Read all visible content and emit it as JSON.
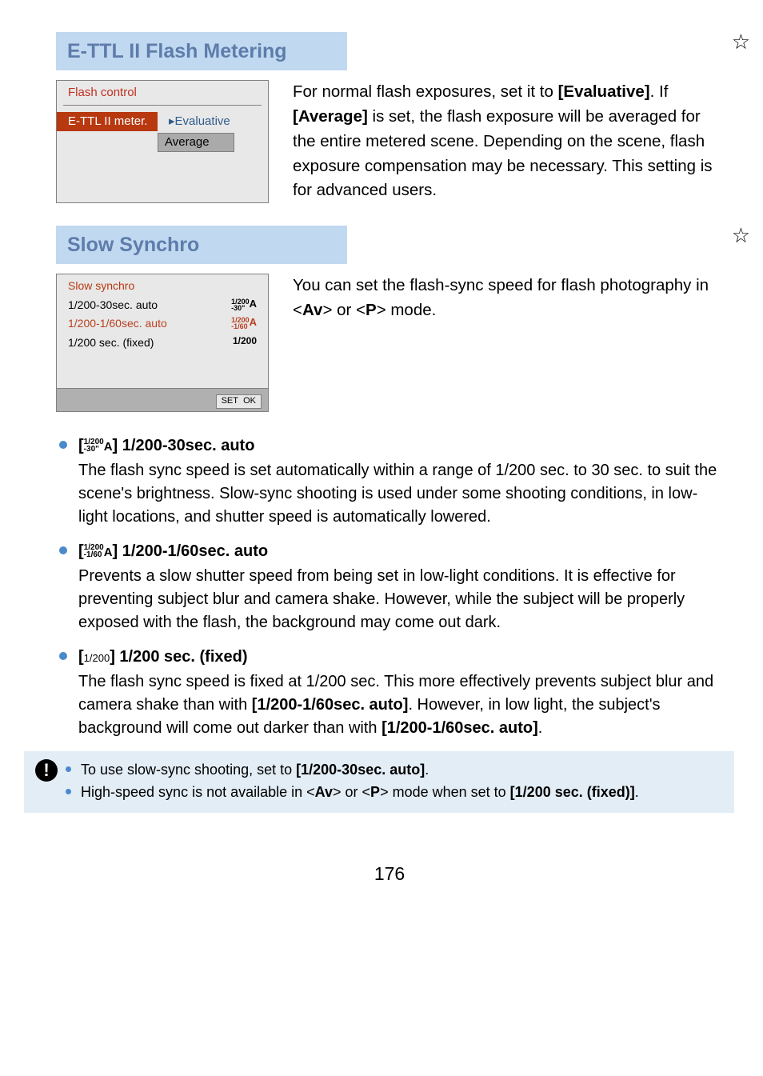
{
  "section1": {
    "title": "E-TTL II Flash Metering",
    "star": "☆",
    "menu": {
      "header": "Flash control",
      "row_label": "E-TTL II meter.",
      "opt_marker": "▸",
      "opt1": "Evaluative",
      "opt2": "Average"
    },
    "body": "For normal flash exposures, set it to [Evaluative]. If [Average] is set, the flash exposure will be averaged for the entire metered scene. Depending on the scene, flash exposure compensation may be necessary. This setting is for advanced users.",
    "body_bold1": "[Evaluative]",
    "body_bold2": "[Average]"
  },
  "section2": {
    "title": "Slow Synchro",
    "star": "☆",
    "menu": {
      "header": "Slow synchro",
      "r1_label": "1/200-30sec. auto",
      "r1_top": "1/200",
      "r1_bot": "-30\"",
      "r1_a": "A",
      "r2_label": "1/200-1/60sec. auto",
      "r2_top": "1/200",
      "r2_bot": "-1/60",
      "r2_a": "A",
      "r3_label": "1/200 sec. (fixed)",
      "r3_val": "1/200",
      "footer_set": "SET",
      "footer_ok": "OK"
    },
    "body_pre": "You can set the flash-sync speed for flash photography in <",
    "av": "Av",
    "body_mid": "> or <",
    "p": "P",
    "body_post": "> mode."
  },
  "bullets": {
    "b1": {
      "icon_top": "1/200",
      "icon_bot": "-30\"",
      "icon_a": "A",
      "title_pre": "[",
      "title_post": "] 1/200-30sec. auto",
      "body": "The flash sync speed is set automatically within a range of 1/200 sec. to 30 sec. to suit the scene's brightness. Slow-sync shooting is used under some shooting conditions, in low-light locations, and shutter speed is automatically lowered."
    },
    "b2": {
      "icon_top": "1/200",
      "icon_bot": "-1/60",
      "icon_a": "A",
      "title_pre": "[",
      "title_post": "] 1/200-1/60sec. auto",
      "body": "Prevents a slow shutter speed from being set in low-light conditions. It is effective for preventing subject blur and camera shake. However, while the subject will be properly exposed with the flash, the background may come out dark."
    },
    "b3": {
      "icon": "1/200",
      "title_pre": "[",
      "title_post": "] 1/200 sec. (fixed)",
      "body_pre": "The flash sync speed is fixed at 1/200 sec. This more effectively prevents subject blur and camera shake than with ",
      "bold1": "[1/200-1/60sec. auto]",
      "body_mid": ". However, in low light, the subject's background will come out darker than with ",
      "bold2": "[1/200-1/60sec. auto]",
      "body_post": "."
    }
  },
  "notes": {
    "icon": "!",
    "n1_pre": "To use slow-sync shooting, set to ",
    "n1_bold": "[1/200-30sec. auto]",
    "n1_post": ".",
    "n2_pre": "High-speed sync is not available in <",
    "av": "Av",
    "n2_mid": "> or <",
    "p": "P",
    "n2_mid2": "> mode when set to ",
    "n2_bold": "[1/200 sec. (fixed)]",
    "n2_post": "."
  },
  "page": "176"
}
